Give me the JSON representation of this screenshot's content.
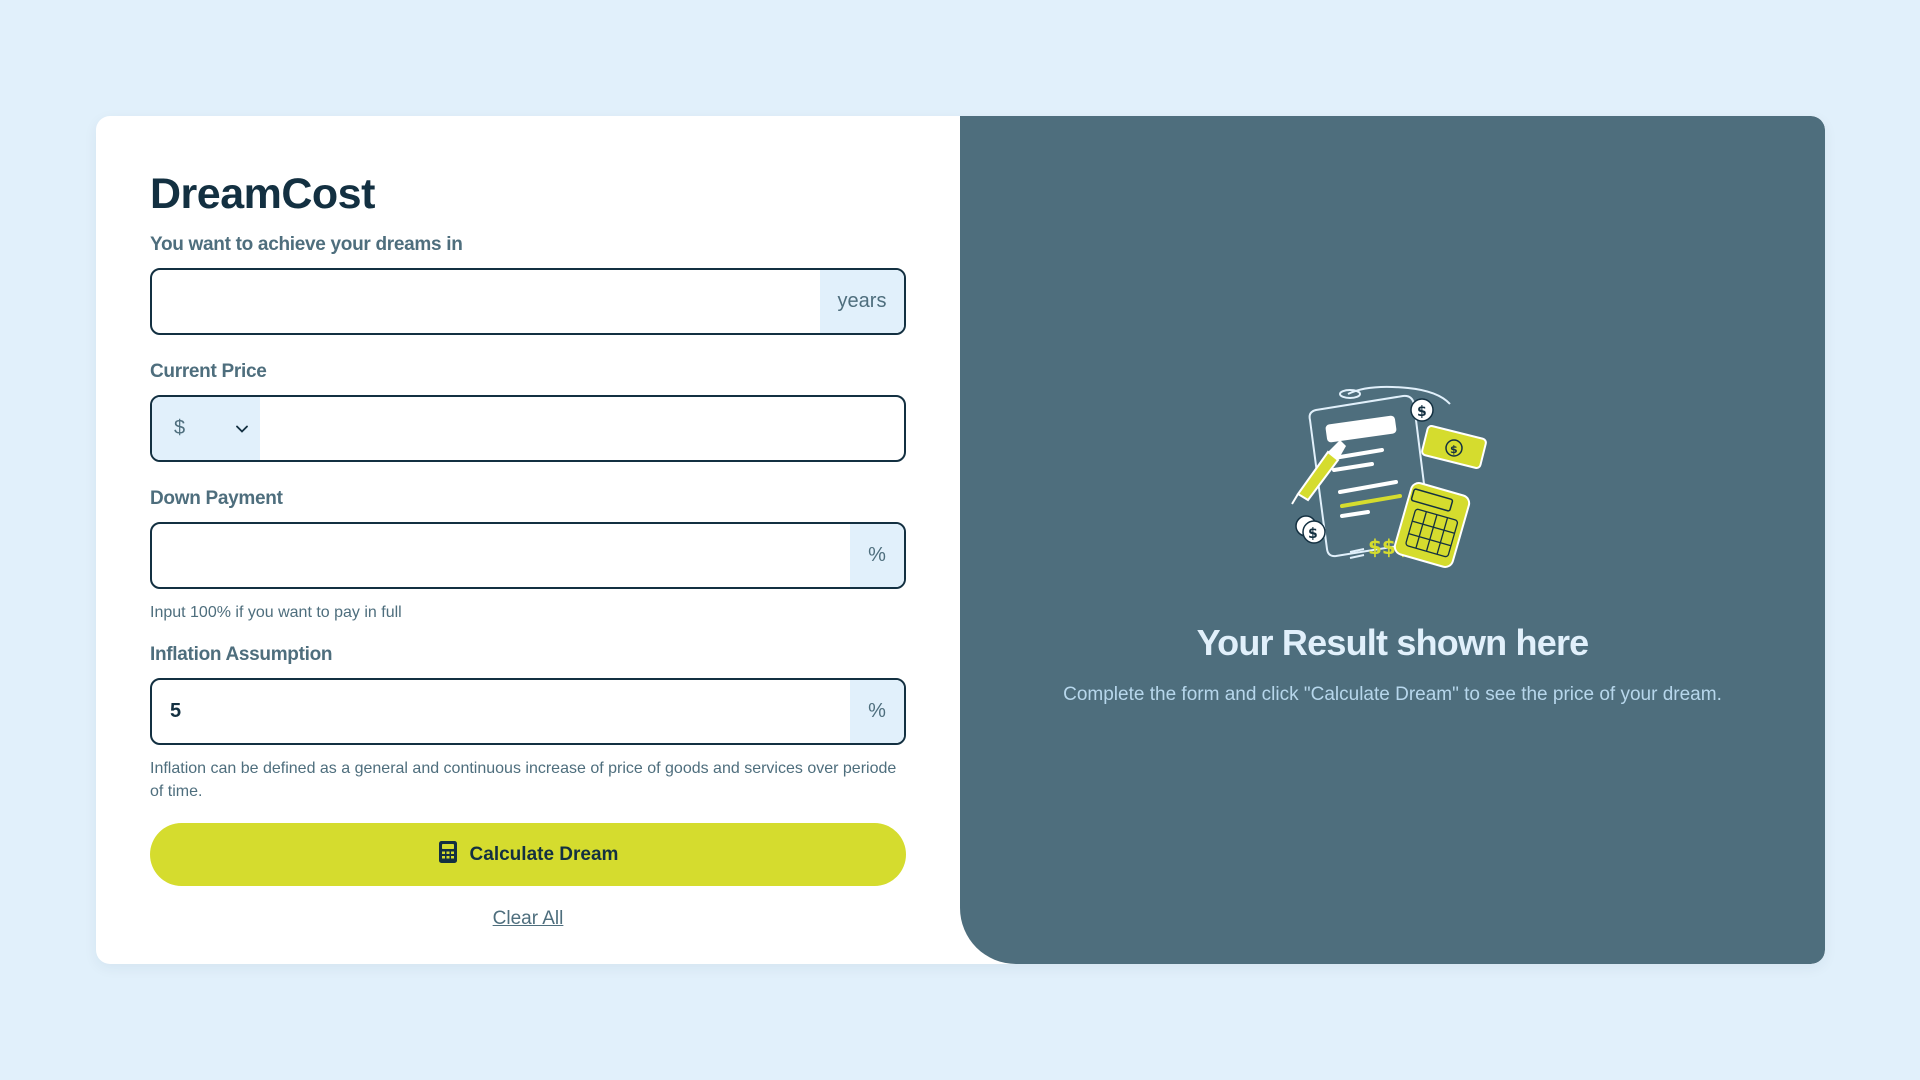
{
  "app": {
    "title": "DreamCost"
  },
  "form": {
    "years": {
      "label": "You want to achieve your dreams in",
      "value": "",
      "suffix": "years"
    },
    "price": {
      "label": "Current Price",
      "currency": "$",
      "value": ""
    },
    "down_payment": {
      "label": "Down Payment",
      "value": "",
      "suffix": "%",
      "hint": "Input 100% if you want to pay in full"
    },
    "inflation": {
      "label": "Inflation Assumption",
      "value": "5",
      "suffix": "%",
      "hint": "Inflation can be defined as a general and continuous increase of price of goods and services over periode of time."
    },
    "calculate_label": "Calculate Dream",
    "clear_label": "Clear All"
  },
  "result": {
    "title": "Your Result shown here",
    "description": "Complete the form and click \"Calculate Dream\" to see the price of your dream."
  },
  "icons": {
    "calculator": "calculator-icon",
    "chevron": "chevron-down-icon",
    "illustration": "finance-document-illustration"
  },
  "colors": {
    "background": "#e1f0fb",
    "primary_dark": "#133041",
    "muted": "#4e6e7d",
    "accent": "#d5dc2e",
    "result_panel": "#4e6e7d"
  }
}
